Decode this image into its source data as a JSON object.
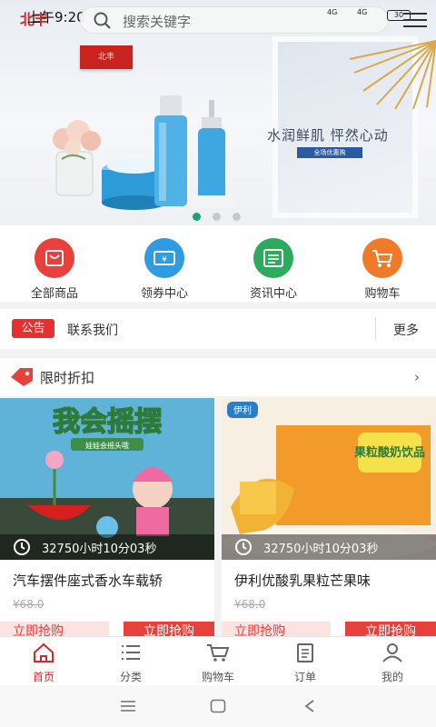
{
  "status_bar": {
    "time": "上午9:20",
    "signal_1": "4G",
    "signal_2": "4G",
    "battery": "30"
  },
  "logo_text": "北丰",
  "search": {
    "placeholder": "搜索关键字"
  },
  "banner": {
    "tag": "北丰",
    "slogan": "水润鲜肌 怦然心动",
    "chip": "全场优惠购",
    "dots": 3,
    "active_dot": 0
  },
  "categories": [
    {
      "label": "全部商品",
      "icon": "shop-bag-icon",
      "color": "#e8403a"
    },
    {
      "label": "领券中心",
      "icon": "coupon-icon",
      "color": "#2f9be0"
    },
    {
      "label": "资讯中心",
      "icon": "news-icon",
      "color": "#2eaa5c"
    },
    {
      "label": "购物车",
      "icon": "cart-icon",
      "color": "#f07a2a"
    }
  ],
  "notice": {
    "badge": "公告",
    "text": "联系我们",
    "more": "更多"
  },
  "section": {
    "title": "限时折扣"
  },
  "products": [
    {
      "image_title": "我会摇摆",
      "image_sub": "娃娃会摇头哦",
      "timer": "32750小时10分03秒",
      "name": "汽车摆件座式香水车载轿",
      "price": "¥68.0",
      "btn_left": "立即抢购",
      "btn_right": "立即抢购"
    },
    {
      "image_title": "果粒酸奶饮品",
      "image_brand": "伊利",
      "timer": "32750小时10分03秒",
      "name": "伊利优酸乳果粒芒果味",
      "price": "¥68.0",
      "btn_left": "立即抢购",
      "btn_right": "立即抢购"
    }
  ],
  "tabs": [
    {
      "label": "首页",
      "icon": "home-icon",
      "active": true
    },
    {
      "label": "分类",
      "icon": "list-icon",
      "active": false
    },
    {
      "label": "购物车",
      "icon": "cart-icon",
      "active": false
    },
    {
      "label": "订单",
      "icon": "order-icon",
      "active": false
    },
    {
      "label": "我的",
      "icon": "user-icon",
      "active": false
    }
  ],
  "colors": {
    "accent": "#d42a2a",
    "button_red": "#e8403a"
  }
}
